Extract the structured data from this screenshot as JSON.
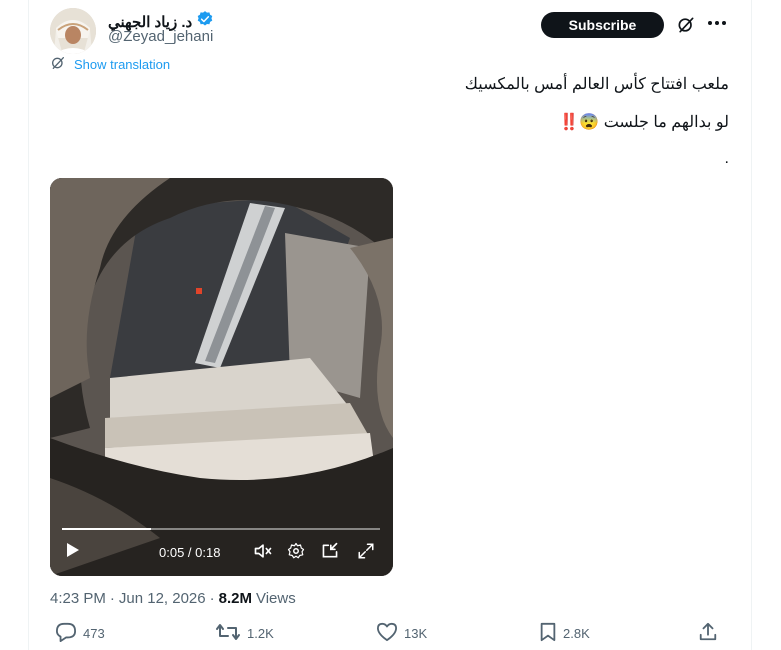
{
  "author": {
    "display_name": "د. زياد الجهني",
    "handle": "@Zeyad_jehani",
    "verified_color": "#1d9bf0"
  },
  "header": {
    "subscribe_label": "Subscribe",
    "grok_icon": "grok-icon",
    "more_icon": "more-icon"
  },
  "post": {
    "translate_label": "Show translation",
    "line1": "ملعب افتتاح كأس العالم أمس بالمكسيك",
    "line2": "لو بدالهم ما جلست 😨‼️",
    "line3": "."
  },
  "video": {
    "time_display": "0:05 / 0:18",
    "progress_fraction": 0.28
  },
  "meta": {
    "time": "4:23 PM",
    "date": "Jun 12, 2026",
    "views_count": "8.2M",
    "views_label": "Views"
  },
  "actions": {
    "replies": "473",
    "reposts": "1.2K",
    "likes": "13K",
    "bookmarks": "2.8K"
  },
  "colors": {
    "accent": "#1d9bf0",
    "text": "#0f1419",
    "secondary": "#536471"
  }
}
